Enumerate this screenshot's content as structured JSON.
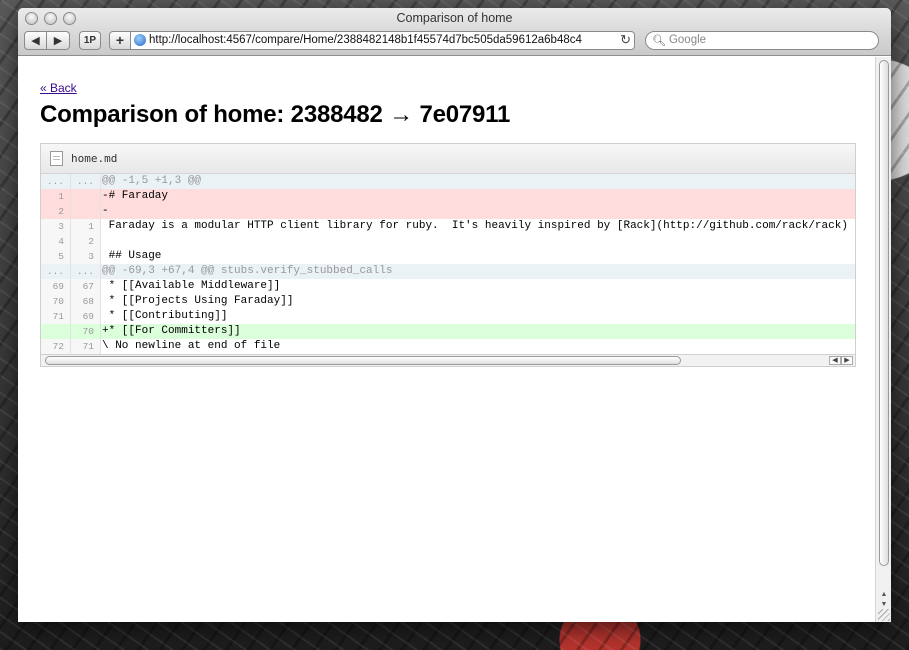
{
  "window": {
    "title": "Comparison of home"
  },
  "toolbar": {
    "back_icon": "◀",
    "forward_icon": "▶",
    "onepassword_label": "1P",
    "add_label": "+",
    "url": "http://localhost:4567/compare/Home/2388482148b1f45574d7bc505da59612a6b48c4",
    "reload_icon": "↻",
    "search_placeholder": "Google"
  },
  "page": {
    "back_link": "« Back",
    "heading": "Comparison of home: 2388482 → 7e07911"
  },
  "diff": {
    "filename": "home.md",
    "rows": [
      {
        "type": "hunk",
        "old": "...",
        "new": "...",
        "text": "@@ -1,5 +1,3 @@"
      },
      {
        "type": "del",
        "old": "1",
        "new": "",
        "text": "-# Faraday"
      },
      {
        "type": "del",
        "old": "2",
        "new": "",
        "text": "-"
      },
      {
        "type": "ctx",
        "old": "3",
        "new": "1",
        "text": " Faraday is a modular HTTP client library for ruby.  It's heavily inspired by [Rack](http://github.com/rack/rack) and uses"
      },
      {
        "type": "ctx",
        "old": "4",
        "new": "2",
        "text": " "
      },
      {
        "type": "ctx",
        "old": "5",
        "new": "3",
        "text": " ## Usage"
      },
      {
        "type": "hunk",
        "old": "...",
        "new": "...",
        "text": "@@ -69,3 +67,4 @@ stubs.verify_stubbed_calls"
      },
      {
        "type": "ctx",
        "old": "69",
        "new": "67",
        "text": " * [[Available Middleware]]"
      },
      {
        "type": "ctx",
        "old": "70",
        "new": "68",
        "text": " * [[Projects Using Faraday]]"
      },
      {
        "type": "ctx",
        "old": "71",
        "new": "69",
        "text": " * [[Contributing]]"
      },
      {
        "type": "add",
        "old": "",
        "new": "70",
        "text": "+* [[For Committers]]"
      },
      {
        "type": "ctx",
        "old": "72",
        "new": "71",
        "text": "\\ No newline at end of file"
      }
    ]
  },
  "colors": {
    "deleted_row": "#ffdddd",
    "added_row": "#dbffdb",
    "hunk_row": "#eaf2f5",
    "link": "#3a0b8f"
  },
  "icons": {
    "file": "document-icon",
    "globe": "globe-icon",
    "search": "magnifier-icon"
  }
}
